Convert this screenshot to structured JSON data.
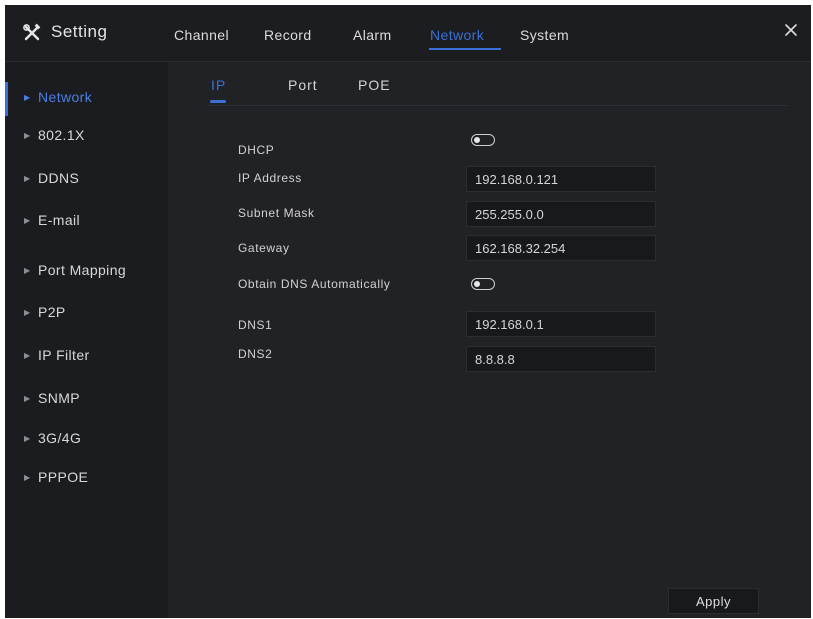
{
  "header": {
    "title": "Setting",
    "tabs": [
      {
        "label": "Channel",
        "active": false
      },
      {
        "label": "Record",
        "active": false
      },
      {
        "label": "Alarm",
        "active": false
      },
      {
        "label": "Network",
        "active": true
      },
      {
        "label": "System",
        "active": false
      }
    ]
  },
  "sidebar": {
    "items": [
      {
        "label": "Network",
        "active": true
      },
      {
        "label": "802.1X",
        "active": false
      },
      {
        "label": "DDNS",
        "active": false
      },
      {
        "label": "E-mail",
        "active": false
      },
      {
        "label": "Port Mapping",
        "active": false
      },
      {
        "label": "P2P",
        "active": false
      },
      {
        "label": "IP Filter",
        "active": false
      },
      {
        "label": "SNMP",
        "active": false
      },
      {
        "label": "3G/4G",
        "active": false
      },
      {
        "label": "PPPOE",
        "active": false
      }
    ]
  },
  "subtabs": [
    {
      "label": "IP",
      "active": true
    },
    {
      "label": "Port",
      "active": false
    },
    {
      "label": "POE",
      "active": false
    }
  ],
  "form": {
    "dhcp_label": "DHCP",
    "dhcp_enabled": false,
    "ip_address_label": "IP Address",
    "ip_address": "192.168.0.121",
    "subnet_mask_label": "Subnet Mask",
    "subnet_mask": "255.255.0.0",
    "gateway_label": "Gateway",
    "gateway": "162.168.32.254",
    "obtain_dns_label": "Obtain DNS Automatically",
    "obtain_dns_enabled": false,
    "dns1_label": "DNS1",
    "dns1": "192.168.0.1",
    "dns2_label": "DNS2",
    "dns2": "8.8.8.8"
  },
  "footer": {
    "apply_label": "Apply"
  },
  "colors": {
    "accent": "#3b6fd6",
    "background": "#212226",
    "panel": "#1b1c1f",
    "input": "#18191c"
  },
  "icons": {
    "setting": "settings-tools-icon",
    "close": "close-icon",
    "arrow": "triangle-right-icon"
  }
}
